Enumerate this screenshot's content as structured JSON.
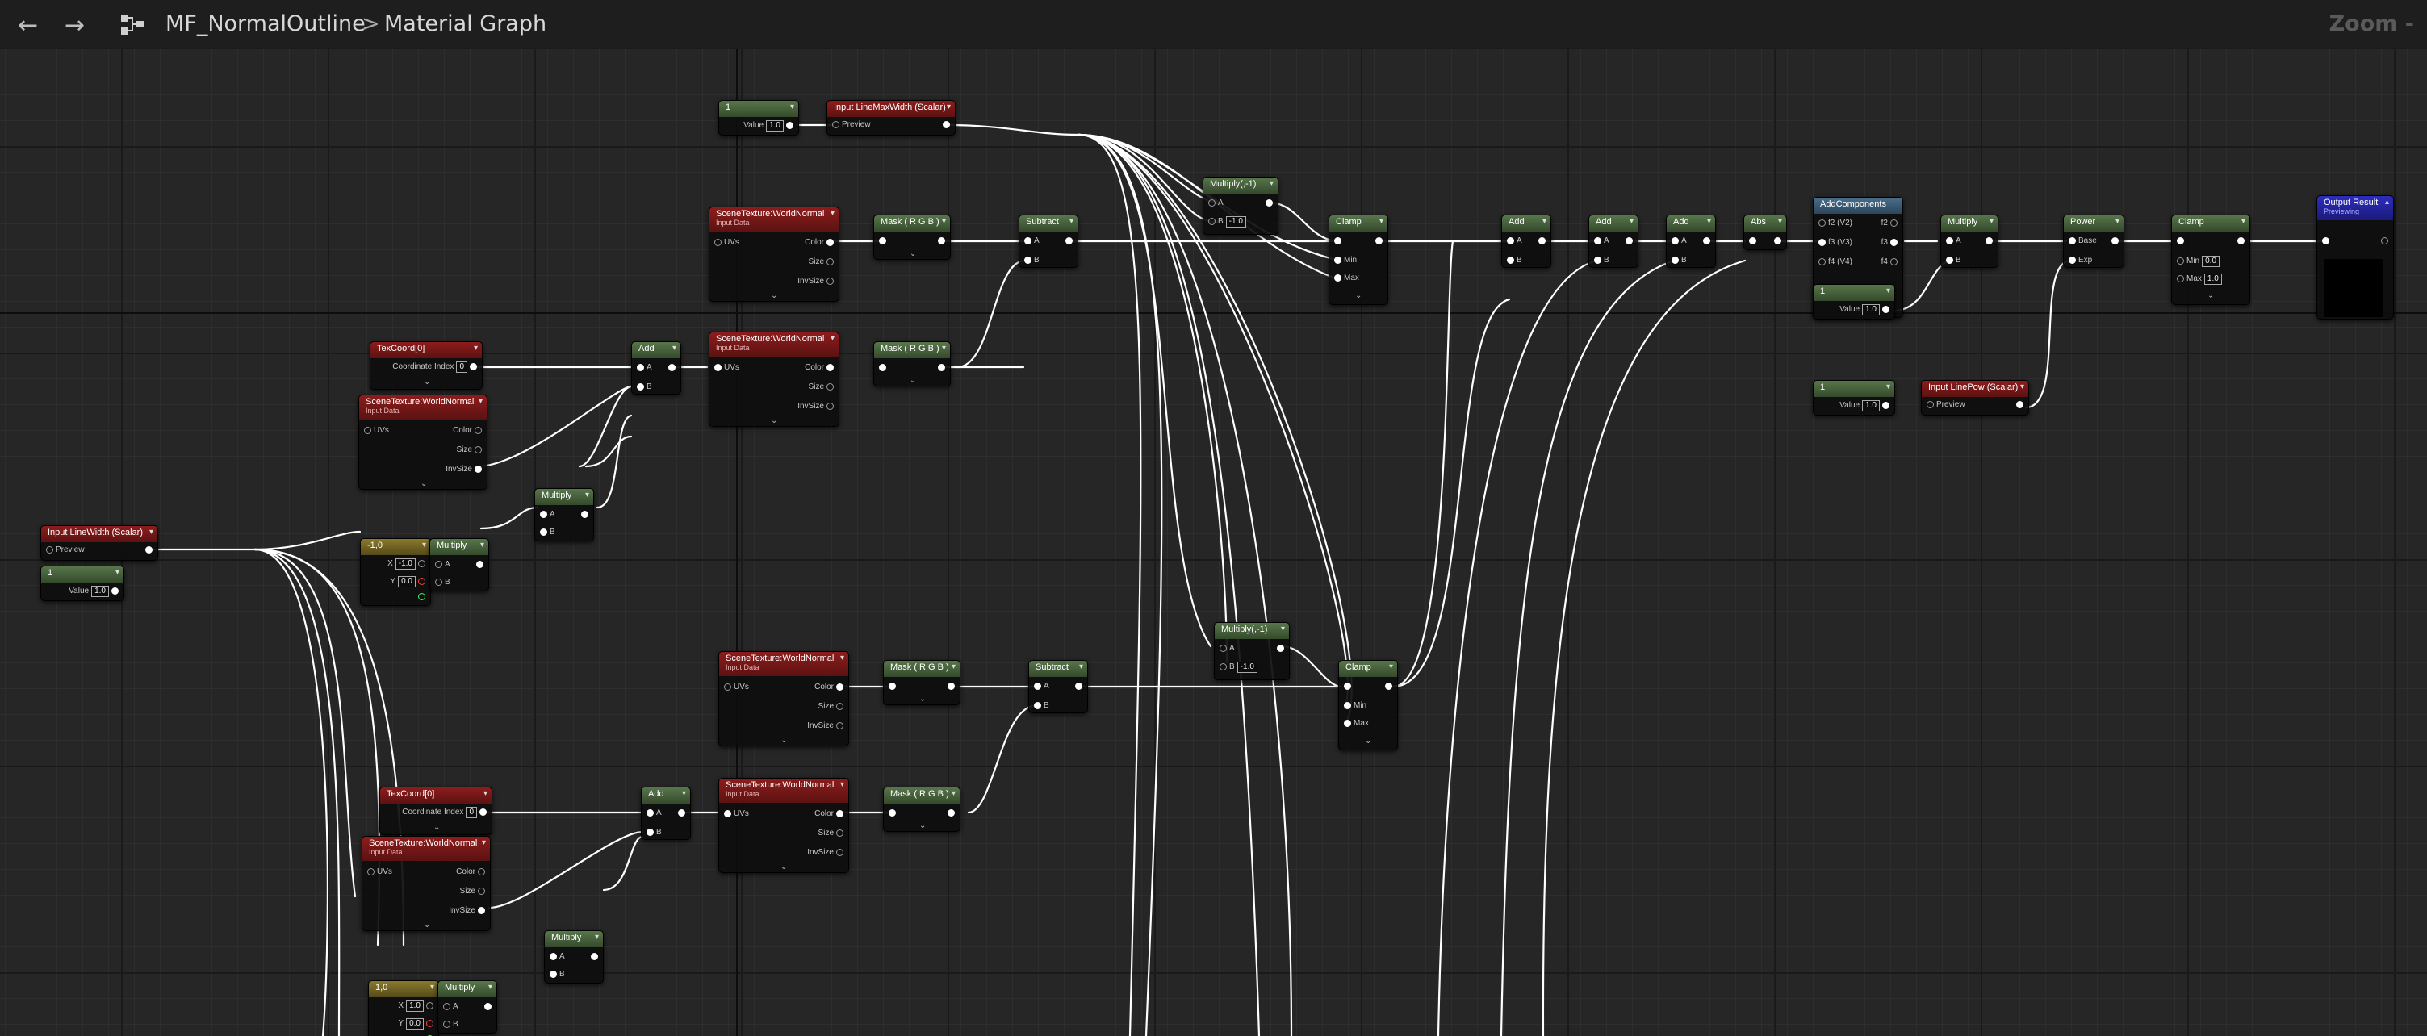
{
  "toolbar": {
    "back_icon": "←",
    "forward_icon": "→",
    "hierarchy_icon": "hierarchy-icon",
    "asset_name": "MF_NormalOutline",
    "separator": ">",
    "graph_name": "Material Graph",
    "zoom_label": "Zoom -"
  },
  "common": {
    "uvs": "UVs",
    "color": "Color",
    "size": "Size",
    "invsize": "InvSize",
    "a": "A",
    "b": "B",
    "min": "Min",
    "max": "Max",
    "x": "X",
    "y": "Y",
    "value": "Value",
    "preview": "Preview",
    "coord_index": "Coordinate Index",
    "base": "Base",
    "exp": "Exp",
    "f2": "f2 (V2)",
    "f3": "f3 (V3)",
    "f4": "f4 (V4)",
    "o2": "f2",
    "o3": "f3",
    "o4": "f4",
    "input_data": "Input Data",
    "previewing": "Previewing"
  },
  "nodes": {
    "const_top_title": "1",
    "const_top_value": "1.0",
    "param_maxwidth_title": "Input LineMaxWidth (Scalar)",
    "st1_title": "SceneTexture:WorldNormal",
    "mask1_title": "Mask ( R G B )",
    "subtract1_title": "Subtract",
    "multiply_neg1_title": "Multiply(,-1)",
    "multiply_neg1_b": "-1.0",
    "clamp1_title": "Clamp",
    "add1_title": "Add",
    "add2_title": "Add",
    "add3_title": "Add",
    "abs_title": "Abs",
    "append_title": "AddComponents",
    "multiply_top_title": "Multiply",
    "power_title": "Power",
    "clamp_out_title": "Clamp",
    "clamp_out_min": "0.0",
    "clamp_out_max": "1.0",
    "output_title": "Output Result",
    "const_mid_title": "1",
    "const_mid_value": "1.0",
    "const_pow_title": "1",
    "const_pow_value": "1.0",
    "param_pow_title": "Input LinePow (Scalar)",
    "texcoord1_title": "TexCoord[0]",
    "texcoord1_index": "0",
    "add_uv1_title": "Add",
    "st2_title": "SceneTexture:WorldNormal",
    "mask2_title": "Mask ( R G B )",
    "st3_title": "SceneTexture:WorldNormal",
    "multiply_uv1_title": "Multiply",
    "vec2_1_title": "-1,0",
    "vec2_1_x": "-1.0",
    "vec2_1_y": "0.0",
    "multiply_uv1b_title": "Multiply",
    "param_linewidth_title": "Input LineWidth (Scalar)",
    "const_lw_title": "1",
    "const_lw_value": "1.0",
    "st4_title": "SceneTexture:WorldNormal",
    "mask3_title": "Mask ( R G B )",
    "subtract2_title": "Subtract",
    "multiply_neg2_title": "Multiply(,-1)",
    "multiply_neg2_b": "-1.0",
    "clamp2_title": "Clamp",
    "texcoord2_title": "TexCoord[0]",
    "texcoord2_index": "0",
    "add_uv2_title": "Add",
    "st5_title": "SceneTexture:WorldNormal",
    "mask4_title": "Mask ( R G B )",
    "st6_title": "SceneTexture:WorldNormal",
    "multiply_uv2_title": "Multiply",
    "vec2_2_title": "1,0",
    "vec2_2_x": "1.0",
    "vec2_2_y": "0.0",
    "multiply_uv2b_title": "Multiply"
  },
  "colors": {
    "graph_bg": "#262626",
    "param_header": "#8e1c1c",
    "math_header": "#58764a",
    "vector_header": "#8a7a2c",
    "append_header": "#4a6e8a",
    "output_header": "#2d2dbe",
    "wire": "#ffffff"
  }
}
